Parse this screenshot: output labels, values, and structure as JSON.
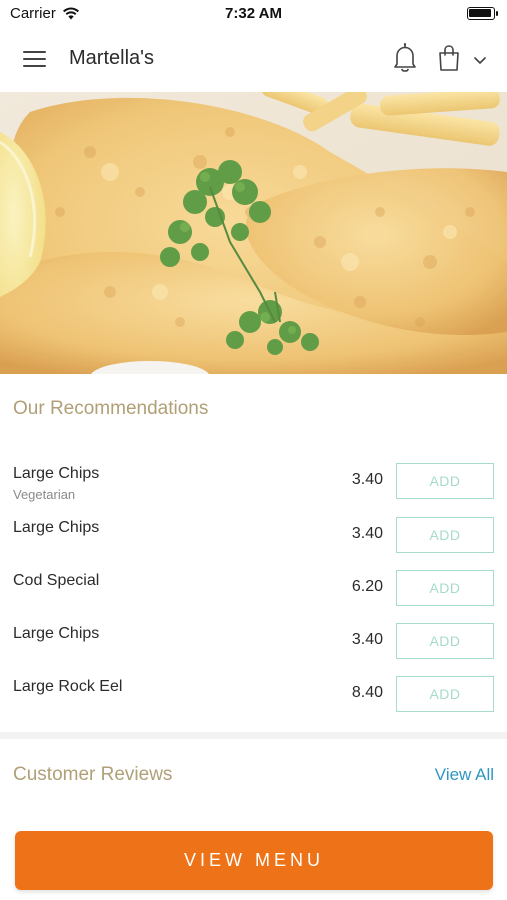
{
  "status_bar": {
    "carrier": "Carrier",
    "time": "7:32 AM",
    "battery_level": 0.95
  },
  "nav": {
    "title": "Martella's",
    "icons": [
      "menu-icon",
      "bell-icon",
      "shopping-bag-icon",
      "chevron-down-icon"
    ]
  },
  "recommendations": {
    "title": "Our Recommendations",
    "add_label": "ADD",
    "items": [
      {
        "name": "Large Chips",
        "subtitle": "Vegetarian",
        "price": "3.40"
      },
      {
        "name": "Large Chips",
        "subtitle": "",
        "price": "3.40"
      },
      {
        "name": "Cod Special",
        "subtitle": "",
        "price": "6.20"
      },
      {
        "name": "Large Chips",
        "subtitle": "",
        "price": "3.40"
      },
      {
        "name": "Large Rock Eel",
        "subtitle": "",
        "price": "8.40"
      }
    ]
  },
  "reviews": {
    "title": "Customer Reviews",
    "view_all": "View All"
  },
  "footer": {
    "view_menu": "VIEW MENU"
  },
  "colors": {
    "accent_orange": "#ee7318",
    "section_title": "#b0a078",
    "add_button": "#a6dcc8",
    "link_blue": "#2f97c1"
  }
}
